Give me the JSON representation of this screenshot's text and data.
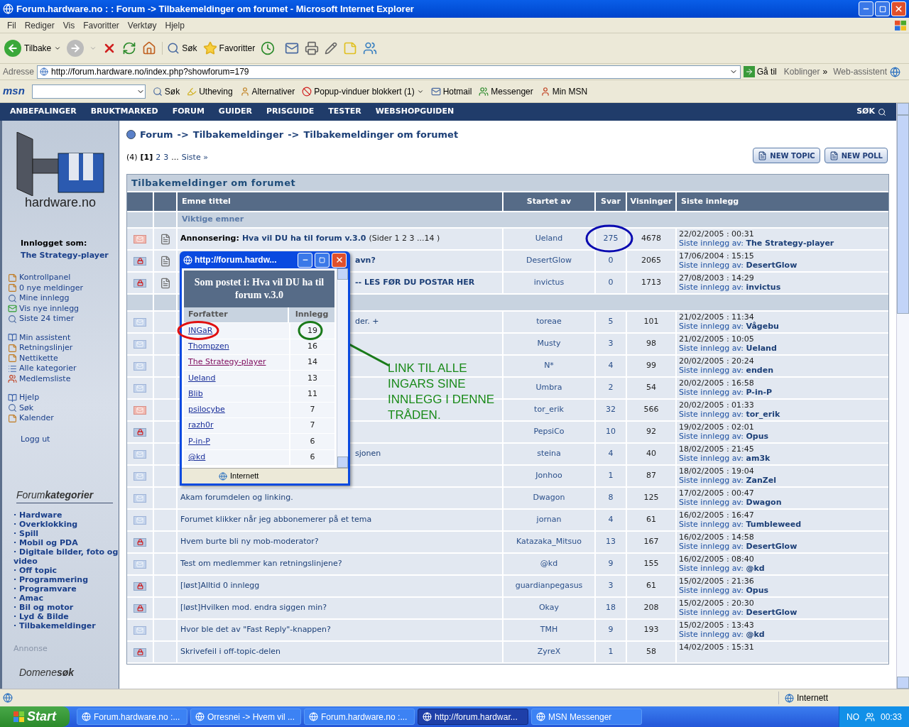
{
  "window": {
    "title": "Forum.hardware.no : : Forum -> Tilbakemeldinger om forumet - Microsoft Internet Explorer"
  },
  "menu": [
    "Fil",
    "Rediger",
    "Vis",
    "Favoritter",
    "Verktøy",
    "Hjelp"
  ],
  "toolbar": {
    "back": "Tilbake",
    "search": "Søk",
    "favorites": "Favoritter"
  },
  "address": {
    "label": "Adresse",
    "url": "http://forum.hardware.no/index.php?showforum=179",
    "go": "Gå til",
    "links": "Koblinger",
    "chevron": "»",
    "assistant": "Web-assistent"
  },
  "msn_bar": {
    "logo": "msn",
    "search": "Søk",
    "highlight": "Utheving",
    "options": "Alternativer",
    "popup_blocker": "Popup-vinduer blokkert (1)",
    "hotmail": "Hotmail",
    "messenger": "Messenger",
    "my_msn": "Min MSN"
  },
  "nav": {
    "items": [
      "ANBEFALINGER",
      "BRUKTMARKED",
      "FORUM",
      "GUIDER",
      "PRISGUIDE",
      "TESTER",
      "WEBSHOPGUIDEN"
    ],
    "search": "SØK"
  },
  "sidebar": {
    "logo_text": "hardware.no",
    "logged_in_label": "Innlogget som:",
    "user": "The Strategy-player",
    "link_groups": [
      [
        {
          "label": "Kontrollpanel",
          "kind": "note"
        },
        {
          "label": "0 nye meldinger",
          "kind": "note"
        },
        {
          "label": "Mine innlegg",
          "kind": "lookup"
        },
        {
          "label": "Vis nye innlegg",
          "kind": "message"
        },
        {
          "label": "Siste 24 timer",
          "kind": "lookup"
        }
      ],
      [
        {
          "label": "Min assistent",
          "kind": "guide"
        },
        {
          "label": "Retningslinjer",
          "kind": "note"
        },
        {
          "label": "Nettikette",
          "kind": "note"
        },
        {
          "label": "Alle kategorier",
          "kind": "index"
        },
        {
          "label": "Medlemsliste",
          "kind": "members"
        }
      ],
      [
        {
          "label": "Hjelp",
          "kind": "guide"
        },
        {
          "label": "Søk",
          "kind": "lookup"
        },
        {
          "label": "Kalender",
          "kind": "note"
        }
      ]
    ],
    "logout": "Logg ut",
    "categories_title": "Forum**kategorier**",
    "categories": [
      "· Hardware",
      "· Overklokking",
      "· Spill",
      "· Mobil og PDA",
      "· Digitale bilder, foto og video",
      "· Off topic",
      "· Programmering",
      "· Programvare",
      "· Amac",
      "· Bil og motor",
      "· Lyd & Bilde",
      "· Tilbakemeldinger"
    ],
    "ad_label": "Annonse",
    "domain_search": "Domene**søk**"
  },
  "breadcrumb": [
    "Forum",
    "->",
    "Tilbakemeldinger",
    "->",
    "Tilbakemeldinger om forumet"
  ],
  "pagination": {
    "count": "(4)",
    "pages": [
      {
        "label": "[1]",
        "selected": true
      },
      {
        "label": "2",
        "selected": false
      },
      {
        "label": "3",
        "selected": false
      }
    ],
    "ellipsis": "...",
    "last": "Siste »"
  },
  "buttons": [
    "NEW TOPIC",
    "NEW POLL"
  ],
  "forum_table": {
    "title": "Tilbakemeldinger om forumet",
    "columns": [
      "Emne tittel",
      "Startet av",
      "Svar",
      "Visninger",
      "Siste innlegg"
    ],
    "important_label": "Viktige emner",
    "important_topics": [
      {
        "kind": "hot",
        "prefix": "Annonsering:",
        "title": "Hva vil DU ha til forum v.3.0",
        "pages": "(Sider 1 2 3 ...14 )",
        "covered": false,
        "starter": "Ueland",
        "replies": "275",
        "views": "4678",
        "date": "22/02/2005 : 00:31",
        "by_label": "Siste innlegg av:",
        "by": "The Strategy-player"
      },
      {
        "kind": "locked",
        "title": "avn?",
        "covered": true,
        "starter": "DesertGlow",
        "replies": "0",
        "views": "2065",
        "date": "17/06/2004 : 15:15",
        "by_label": "Siste innlegg av:",
        "by": "DesertGlow"
      },
      {
        "kind": "locked",
        "title": "-- LES FØR DU POSTAR HER",
        "covered": true,
        "starter": "invictus",
        "replies": "0",
        "views": "1713",
        "date": "27/08/2003 : 14:29",
        "by_label": "Siste innlegg av:",
        "by": "invictus"
      }
    ],
    "topics": [
      {
        "kind": "new",
        "title": "der. +",
        "covered": true,
        "starter": "toreae",
        "replies": "5",
        "views": "101",
        "date": "21/02/2005 : 11:34",
        "by_label": "Siste innlegg av:",
        "by": "Vågebu"
      },
      {
        "kind": "new",
        "starter": "Musty",
        "replies": "3",
        "views": "98",
        "date": "21/02/2005 : 10:05",
        "by_label": "Siste innlegg av:",
        "by": "Ueland"
      },
      {
        "kind": "new",
        "starter": "N*",
        "replies": "4",
        "views": "99",
        "date": "20/02/2005 : 20:24",
        "by_label": "Siste innlegg av:",
        "by": "enden"
      },
      {
        "kind": "new",
        "starter": "Umbra",
        "replies": "2",
        "views": "54",
        "date": "20/02/2005 : 16:58",
        "by_label": "Siste innlegg av:",
        "by": "P-in-P"
      },
      {
        "kind": "hot",
        "starter": "tor_erik",
        "replies": "32",
        "views": "566",
        "date": "20/02/2005 : 01:33",
        "by_label": "Siste innlegg av:",
        "by": "tor_erik"
      },
      {
        "kind": "locked",
        "starter": "PepsiCo",
        "replies": "10",
        "views": "92",
        "date": "19/02/2005 : 02:01",
        "by_label": "Siste innlegg av:",
        "by": "Opus"
      },
      {
        "kind": "new",
        "title": "sjonen",
        "covered": true,
        "starter": "steina",
        "replies": "4",
        "views": "40",
        "date": "18/02/2005 : 21:45",
        "by_label": "Siste innlegg av:",
        "by": "am3k"
      },
      {
        "kind": "new",
        "starter": "Jonhoo",
        "replies": "1",
        "views": "87",
        "date": "18/02/2005 : 19:04",
        "by_label": "Siste innlegg av:",
        "by": "ZanZel"
      },
      {
        "kind": "new",
        "title": "Akam forumdelen og linking.",
        "covered": false,
        "starter": "Dwagon",
        "replies": "8",
        "views": "125",
        "date": "17/02/2005 : 00:47",
        "by_label": "Siste innlegg av:",
        "by": "Dwagon"
      },
      {
        "kind": "new",
        "title": "Forumet klikker når jeg abbonemerer på et tema",
        "covered": false,
        "starter": "jornan",
        "replies": "4",
        "views": "61",
        "date": "16/02/2005 : 16:47",
        "by_label": "Siste innlegg av:",
        "by": "Tumbleweed"
      },
      {
        "kind": "locked",
        "title": "Hvem burte bli ny mob-moderator?",
        "covered": false,
        "starter": "Katazaka_Mitsuo",
        "replies": "13",
        "views": "167",
        "date": "16/02/2005 : 14:58",
        "by_label": "Siste innlegg av:",
        "by": "DesertGlow"
      },
      {
        "kind": "new",
        "title": "Test om medlemmer kan retningslinjene?",
        "covered": false,
        "starter": "@kd",
        "replies": "9",
        "views": "155",
        "date": "16/02/2005 : 08:40",
        "by_label": "Siste innlegg av:",
        "by": "@kd"
      },
      {
        "kind": "locked",
        "title": "[løst]Alltid 0 innlegg",
        "covered": false,
        "starter": "guardianpegasus",
        "replies": "3",
        "views": "61",
        "date": "15/02/2005 : 21:36",
        "by_label": "Siste innlegg av:",
        "by": "Opus"
      },
      {
        "kind": "locked",
        "title": "[løst]Hvilken mod. endra siggen min?",
        "covered": false,
        "starter": "Okay",
        "replies": "18",
        "views": "208",
        "date": "15/02/2005 : 20:30",
        "by_label": "Siste innlegg av:",
        "by": "DesertGlow"
      },
      {
        "kind": "new",
        "title": "Hvor ble det av \"Fast Reply\"-knappen?",
        "covered": false,
        "starter": "TMH",
        "replies": "9",
        "views": "193",
        "date": "15/02/2005 : 13:43",
        "by_label": "Siste innlegg av:",
        "by": "@kd"
      },
      {
        "kind": "locked",
        "title": "Skrivefeil i off-topic-delen",
        "covered": false,
        "starter": "ZyreX",
        "replies": "1",
        "views": "58",
        "date": "14/02/2005 : 15:31"
      }
    ]
  },
  "popup": {
    "title": "http://forum.hardw...",
    "heading": "Som postet i: Hva vil DU ha til forum v.3.0",
    "columns": [
      "Forfatter",
      "Innlegg"
    ],
    "rows": [
      {
        "author": "INGaR",
        "posts": "19",
        "visited": false
      },
      {
        "author": "Thompzen",
        "posts": "16",
        "visited": false
      },
      {
        "author": "The Strategy-player",
        "posts": "14",
        "visited": true
      },
      {
        "author": "Ueland",
        "posts": "13",
        "visited": false
      },
      {
        "author": "Blib",
        "posts": "11",
        "visited": false
      },
      {
        "author": "psilocybe",
        "posts": "7",
        "visited": false
      },
      {
        "author": "razh0r",
        "posts": "7",
        "visited": false
      },
      {
        "author": "P-in-P",
        "posts": "6",
        "visited": false
      },
      {
        "author": "@kd",
        "posts": "6",
        "visited": false
      }
    ],
    "status": "Internett"
  },
  "annotation": {
    "lines": [
      "LINK TIL ALLE",
      "INGARS SINE",
      "INNLEGG I DENNE",
      "TRÅDEN."
    ]
  },
  "status_bar": {
    "zone": "Internett"
  },
  "taskbar": {
    "start": "Start",
    "tasks": [
      {
        "label": "Forum.hardware.no :...",
        "selected": false
      },
      {
        "label": "Orresnei -> Hvem vil ...",
        "selected": false
      },
      {
        "label": "Forum.hardware.no :...",
        "selected": false
      },
      {
        "label": "http://forum.hardwar...",
        "selected": true
      },
      {
        "label": "MSN Messenger",
        "selected": false
      }
    ],
    "language": "NO",
    "clock": "00:33"
  }
}
